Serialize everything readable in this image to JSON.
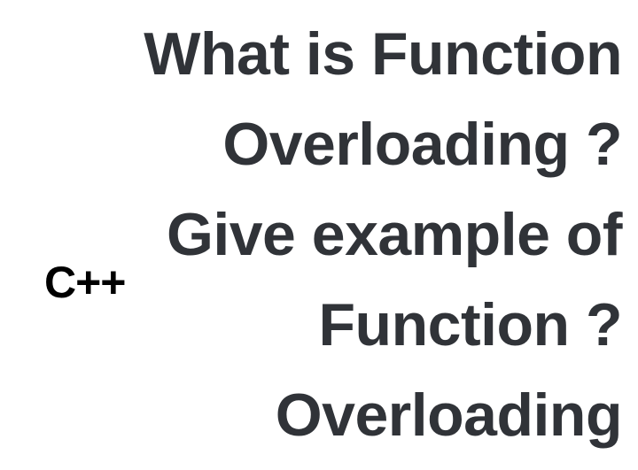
{
  "heading": {
    "text": "What is Function Overloading ? Give example of Function ?Overloading"
  },
  "label": {
    "text": "C++"
  }
}
